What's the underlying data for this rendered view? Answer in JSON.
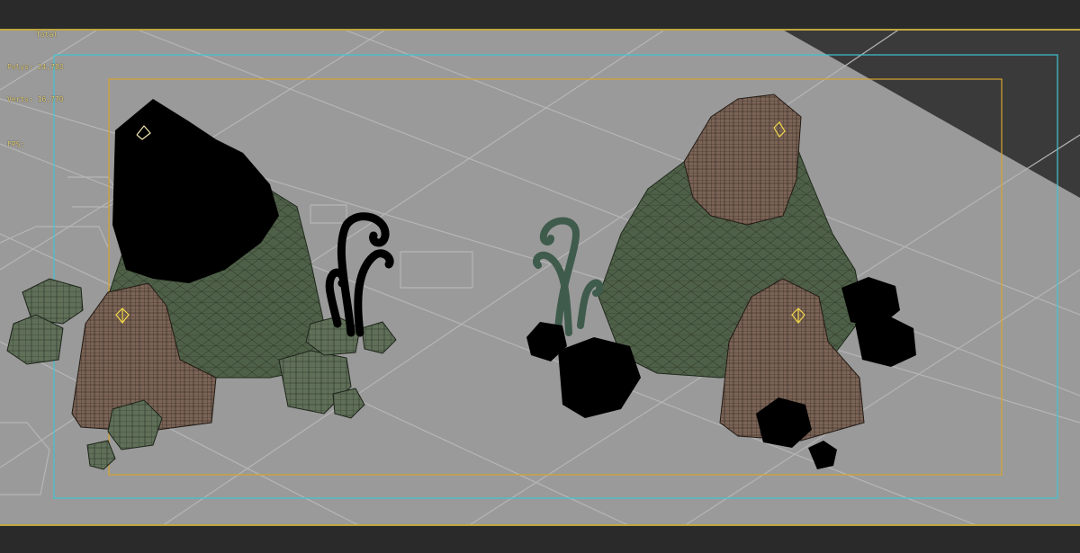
{
  "viewport": {
    "background_color": "#9a9a9a",
    "grid_color": "#b8b8b8",
    "safe_frame_outer_color": "#41c4d2",
    "safe_frame_inner_color": "#d7a32e"
  },
  "stats": {
    "total_label": "Total",
    "polys": "Polys: 24,783",
    "verts": "Verts: 16,770",
    "fps": "FPS:"
  },
  "scene": {
    "objects": [
      {
        "name": "left-rock-mound",
        "selected": true
      },
      {
        "name": "left-curly-vines",
        "selected": true
      },
      {
        "name": "left-boulders",
        "selected": false
      },
      {
        "name": "right-rock-mound",
        "selected": false
      },
      {
        "name": "right-curly-vines",
        "selected": false
      },
      {
        "name": "right-boulders",
        "selected": true
      }
    ]
  }
}
